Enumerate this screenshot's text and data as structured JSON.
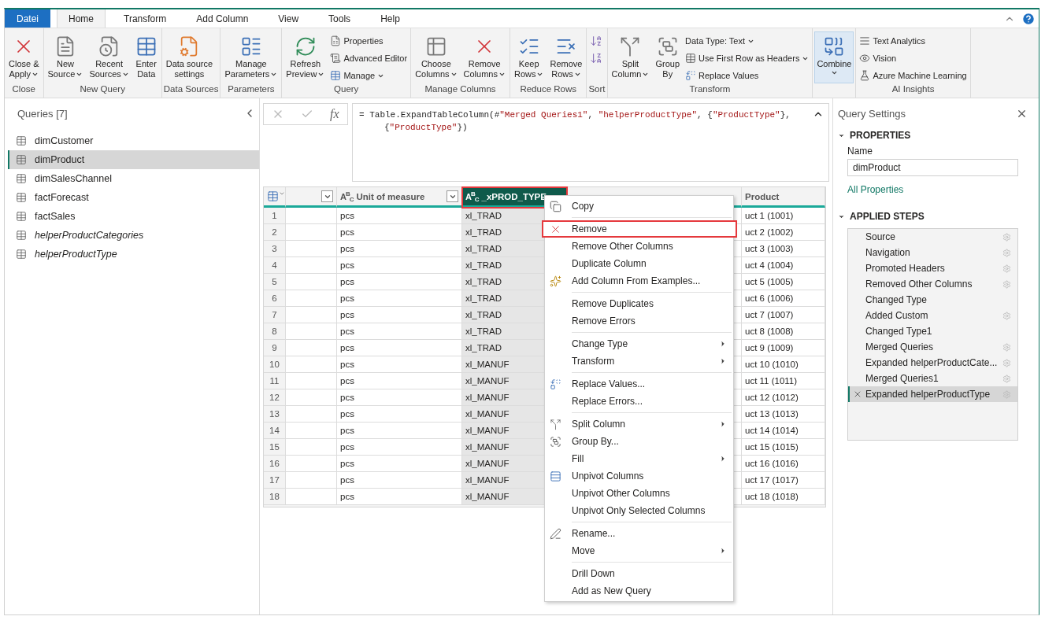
{
  "tabs": [
    {
      "label": "Datei",
      "kind": "file",
      "selected": false
    },
    {
      "label": "Home",
      "kind": "tab",
      "selected": true
    },
    {
      "label": "Transform",
      "kind": "tab",
      "selected": false
    },
    {
      "label": "Add Column",
      "kind": "tab",
      "selected": false
    },
    {
      "label": "View",
      "kind": "tab",
      "selected": false
    },
    {
      "label": "Tools",
      "kind": "tab",
      "selected": false
    },
    {
      "label": "Help",
      "kind": "tab",
      "selected": false
    }
  ],
  "ribbon": {
    "groups": [
      {
        "label": "Close",
        "buttons": [
          {
            "kind": "large",
            "lines": [
              "Close &",
              "Apply"
            ],
            "dropdown": true
          }
        ]
      },
      {
        "label": "New Query",
        "buttons": [
          {
            "kind": "large",
            "lines": [
              "New",
              "Source"
            ],
            "dropdown": true
          },
          {
            "kind": "large",
            "lines": [
              "Recent",
              "Sources"
            ],
            "dropdown": true
          },
          {
            "kind": "large",
            "lines": [
              "Enter",
              "Data"
            ],
            "dropdown": false
          }
        ]
      },
      {
        "label": "Data Sources",
        "buttons": [
          {
            "kind": "large",
            "lines": [
              "Data source",
              "settings"
            ],
            "dropdown": false
          }
        ]
      },
      {
        "label": "Parameters",
        "buttons": [
          {
            "kind": "large",
            "lines": [
              "Manage",
              "Parameters"
            ],
            "dropdown": true
          }
        ]
      },
      {
        "label": "Query",
        "buttons": [
          {
            "kind": "large",
            "lines": [
              "Refresh",
              "Preview"
            ],
            "dropdown": true
          },
          {
            "kind": "small",
            "lines": [
              "Properties"
            ],
            "dropdown": false
          },
          {
            "kind": "small",
            "lines": [
              "Advanced Editor"
            ],
            "dropdown": false
          },
          {
            "kind": "small",
            "lines": [
              "Manage"
            ],
            "dropdown": true
          }
        ]
      },
      {
        "label": "Manage Columns",
        "buttons": [
          {
            "kind": "large",
            "lines": [
              "Choose",
              "Columns"
            ],
            "dropdown": true
          },
          {
            "kind": "large",
            "lines": [
              "Remove",
              "Columns"
            ],
            "dropdown": true
          }
        ]
      },
      {
        "label": "Reduce Rows",
        "buttons": [
          {
            "kind": "large",
            "lines": [
              "Keep",
              "Rows"
            ],
            "dropdown": true
          },
          {
            "kind": "large",
            "lines": [
              "Remove",
              "Rows"
            ],
            "dropdown": true
          }
        ]
      },
      {
        "label": "Sort",
        "buttons": [
          {
            "kind": "icon"
          },
          {
            "kind": "icon"
          }
        ]
      },
      {
        "label": "Transform",
        "buttons": [
          {
            "kind": "large",
            "lines": [
              "Split",
              "Column"
            ],
            "dropdown": true
          },
          {
            "kind": "large",
            "lines": [
              "Group",
              "By"
            ],
            "dropdown": false
          },
          {
            "kind": "small",
            "lines": [
              "Data Type: Text"
            ],
            "dropdown": true
          },
          {
            "kind": "small",
            "lines": [
              "Use First Row as Headers"
            ],
            "dropdown": true
          },
          {
            "kind": "small",
            "lines": [
              "Replace Values"
            ],
            "dropdown": false
          }
        ]
      },
      {
        "buttons": [
          {
            "kind": "large",
            "lines": [
              "Combine"
            ],
            "dropdown": true,
            "highlighted": true
          }
        ]
      },
      {
        "label": "AI Insights",
        "buttons": [
          {
            "kind": "small",
            "lines": [
              "Text Analytics"
            ],
            "dropdown": false
          },
          {
            "kind": "small",
            "lines": [
              "Vision"
            ],
            "dropdown": false
          },
          {
            "kind": "small",
            "lines": [
              "Azure Machine Learning"
            ],
            "dropdown": false
          }
        ]
      }
    ]
  },
  "queries": {
    "title": "Queries [7]",
    "items": [
      {
        "name": "dimCustomer",
        "loaded": true,
        "selected": false
      },
      {
        "name": "dimProduct",
        "loaded": true,
        "selected": true
      },
      {
        "name": "dimSalesChannel",
        "loaded": true,
        "selected": false
      },
      {
        "name": "factForecast",
        "loaded": true,
        "selected": false
      },
      {
        "name": "factSales",
        "loaded": true,
        "selected": false
      },
      {
        "name": "helperProductCategories",
        "loaded": false,
        "selected": false
      },
      {
        "name": "helperProductType",
        "loaded": false,
        "selected": false
      }
    ]
  },
  "formula_bar": {
    "fx": "fx",
    "tokens": [
      {
        "text": "= Table.ExpandTableColumn(#",
        "kind": "plain"
      },
      {
        "text": "\"Merged Queries1\"",
        "kind": "string"
      },
      {
        "text": ", ",
        "kind": "plain"
      },
      {
        "text": "\"helperProductType\"",
        "kind": "string"
      },
      {
        "text": ", {",
        "kind": "plain"
      },
      {
        "text": "\"ProductType\"",
        "kind": "string"
      },
      {
        "text": "}, {",
        "kind": "plain"
      },
      {
        "text": "\"ProductType\"",
        "kind": "string"
      },
      {
        "text": "})",
        "kind": "plain"
      }
    ]
  },
  "table": {
    "columns": [
      {
        "filter": true,
        "selected": false
      },
      {
        "type": "A$^{B}$$_{C}$",
        "label": "Unit of measure",
        "filter": true,
        "selected": false
      },
      {
        "type": "A$^{B}$$_{C}$",
        "label": "_xPROD_TYPE",
        "filter": false,
        "selected": true
      },
      {
        "filter": false,
        "selected": false
      },
      {
        "label": "Product",
        "filter": false,
        "selected": false
      }
    ],
    "rows": [
      [
        "1",
        "pcs",
        "xl_TRAD",
        "uct 1 (1001)"
      ],
      [
        "2",
        "pcs",
        "xl_TRAD",
        "uct 2 (1002)"
      ],
      [
        "3",
        "pcs",
        "xl_TRAD",
        "uct 3 (1003)"
      ],
      [
        "4",
        "pcs",
        "xl_TRAD",
        "uct 4 (1004)"
      ],
      [
        "5",
        "pcs",
        "xl_TRAD",
        "uct 5 (1005)"
      ],
      [
        "6",
        "pcs",
        "xl_TRAD",
        "uct 6 (1006)"
      ],
      [
        "7",
        "pcs",
        "xl_TRAD",
        "uct 7 (1007)"
      ],
      [
        "8",
        "pcs",
        "xl_TRAD",
        "uct 8 (1008)"
      ],
      [
        "9",
        "pcs",
        "xl_TRAD",
        "uct 9 (1009)"
      ],
      [
        "10",
        "pcs",
        "xl_MANUF",
        "uct 10 (1010)"
      ],
      [
        "11",
        "pcs",
        "xl_MANUF",
        "uct 11 (1011)"
      ],
      [
        "12",
        "pcs",
        "xl_MANUF",
        "uct 12 (1012)"
      ],
      [
        "13",
        "pcs",
        "xl_MANUF",
        "uct 13 (1013)"
      ],
      [
        "14",
        "pcs",
        "xl_MANUF",
        "uct 14 (1014)"
      ],
      [
        "15",
        "pcs",
        "xl_MANUF",
        "uct 15 (1015)"
      ],
      [
        "16",
        "pcs",
        "xl_MANUF",
        "uct 16 (1016)"
      ],
      [
        "17",
        "pcs",
        "xl_MANUF",
        "uct 17 (1017)"
      ],
      [
        "18",
        "pcs",
        "xl_MANUF",
        "uct 18 (1018)"
      ]
    ]
  },
  "context_menu": {
    "groups": [
      [
        {
          "label": "Copy",
          "submenu": false,
          "highlighted": false
        }
      ],
      [
        {
          "label": "Remove",
          "submenu": false,
          "highlighted": true
        },
        {
          "label": "Remove Other Columns",
          "submenu": false,
          "highlighted": false
        },
        {
          "label": "Duplicate Column",
          "submenu": false,
          "highlighted": false
        },
        {
          "label": "Add Column From Examples...",
          "submenu": false,
          "highlighted": false
        }
      ],
      [
        {
          "label": "Remove Duplicates",
          "submenu": false,
          "highlighted": false
        },
        {
          "label": "Remove Errors",
          "submenu": false,
          "highlighted": false
        }
      ],
      [
        {
          "label": "Change Type",
          "submenu": true,
          "highlighted": false
        },
        {
          "label": "Transform",
          "submenu": true,
          "highlighted": false
        }
      ],
      [
        {
          "label": "Replace Values...",
          "submenu": false,
          "highlighted": false
        },
        {
          "label": "Replace Errors...",
          "submenu": false,
          "highlighted": false
        }
      ],
      [
        {
          "label": "Split Column",
          "submenu": true,
          "highlighted": false
        },
        {
          "label": "Group By...",
          "submenu": false,
          "highlighted": false
        },
        {
          "label": "Fill",
          "submenu": true,
          "highlighted": false
        },
        {
          "label": "Unpivot Columns",
          "submenu": false,
          "highlighted": false
        },
        {
          "label": "Unpivot Other Columns",
          "submenu": false,
          "highlighted": false
        },
        {
          "label": "Unpivot Only Selected Columns",
          "submenu": false,
          "highlighted": false
        }
      ],
      [
        {
          "label": "Rename...",
          "submenu": false,
          "highlighted": false
        },
        {
          "label": "Move",
          "submenu": true,
          "highlighted": false
        }
      ],
      [
        {
          "label": "Drill Down",
          "submenu": false,
          "highlighted": false
        },
        {
          "label": "Add as New Query",
          "submenu": false,
          "highlighted": false
        }
      ]
    ]
  },
  "query_settings": {
    "title": "Query Settings",
    "properties": {
      "heading": "PROPERTIES",
      "name_label": "Name",
      "name_value": "dimProduct",
      "link": "All Properties"
    },
    "steps_heading": "APPLIED STEPS",
    "steps": [
      {
        "name": "Source",
        "gear": true,
        "selected": false
      },
      {
        "name": "Navigation",
        "gear": true,
        "selected": false
      },
      {
        "name": "Promoted Headers",
        "gear": true,
        "selected": false
      },
      {
        "name": "Removed Other Columns",
        "gear": true,
        "selected": false
      },
      {
        "name": "Changed Type",
        "gear": false,
        "selected": false
      },
      {
        "name": "Added Custom",
        "gear": true,
        "selected": false
      },
      {
        "name": "Changed Type1",
        "gear": false,
        "selected": false
      },
      {
        "name": "Merged Queries",
        "gear": true,
        "selected": false
      },
      {
        "name": "Expanded helperProductCate...",
        "gear": true,
        "selected": false
      },
      {
        "name": "Merged Queries1",
        "gear": true,
        "selected": false
      },
      {
        "name": "Expanded helperProductType",
        "gear": true,
        "selected": true
      }
    ]
  }
}
